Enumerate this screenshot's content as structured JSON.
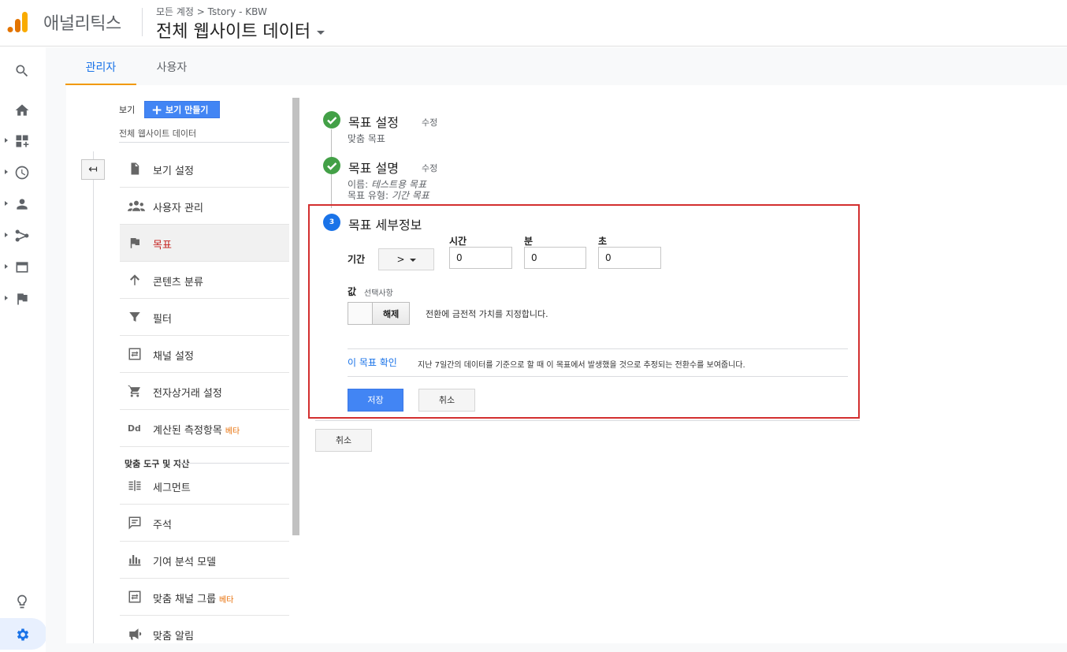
{
  "app": {
    "name": "애널리틱스"
  },
  "header": {
    "breadcrumb": "모든 계정 > Tstory - KBW",
    "view_title": "전체 웹사이트 데이터"
  },
  "tabs": [
    {
      "label": "관리자"
    },
    {
      "label": "사용자"
    }
  ],
  "column": {
    "view_label": "보기",
    "make_view_button": "보기 만들기",
    "view_name": "전체 웹사이트 데이터",
    "back_icon": "back-arrow-icon",
    "items": [
      {
        "label": "보기 설정",
        "icon": "document-icon"
      },
      {
        "label": "사용자 관리",
        "icon": "people-icon"
      },
      {
        "label": "목표",
        "icon": "flag-icon"
      },
      {
        "label": "콘텐츠 분류",
        "icon": "content-grouping-icon"
      },
      {
        "label": "필터",
        "icon": "filter-icon"
      },
      {
        "label": "채널 설정",
        "icon": "channel-icon"
      },
      {
        "label": "전자상거래 설정",
        "icon": "cart-icon"
      },
      {
        "label": "계산된 측정항목",
        "icon": "dd-icon",
        "badge": "베타"
      }
    ],
    "section_header": "맞춤 도구 및 자산",
    "tools": [
      {
        "label": "세그먼트",
        "icon": "segment-icon"
      },
      {
        "label": "주석",
        "icon": "annotation-icon"
      },
      {
        "label": "기여 분석 모델",
        "icon": "attribution-icon"
      },
      {
        "label": "맞춤 채널 그룹",
        "icon": "channel-group-icon",
        "badge": "베타"
      },
      {
        "label": "맞춤 알림",
        "icon": "megaphone-icon"
      }
    ]
  },
  "steps": {
    "step1": {
      "title": "목표 설정",
      "edit": "수정",
      "sub": "맞춤 목표"
    },
    "step2": {
      "title": "목표 설명",
      "edit": "수정",
      "name_label": "이름:",
      "name_value": "테스트용 목표",
      "type_label": "목표 유형:",
      "type_value": "기간 목표"
    },
    "step3": {
      "number": "3",
      "title": "목표 세부정보"
    }
  },
  "details": {
    "duration_label": "기간",
    "operator": ">",
    "hours_label": "시간",
    "hours_value": "0",
    "minutes_label": "분",
    "minutes_value": "0",
    "seconds_label": "초",
    "seconds_value": "0",
    "value_label": "값",
    "value_optional": "선택사항",
    "toggle_state": "해제",
    "toggle_desc": "전환에 금전적 가치를 지정합니다.",
    "verify_link": "이 목표 확인",
    "verify_desc": "지난 7일간의 데이터를 기준으로 할 때 이 목표에서 발생했을 것으로 추정되는 전환수를 보여줍니다.",
    "save": "저장",
    "cancel": "취소"
  },
  "outer_cancel": "취소",
  "colors": {
    "accent": "#1a73e8",
    "active_tab_underline": "#f29900",
    "highlight_box": "#d32f2f",
    "success": "#43a047"
  }
}
